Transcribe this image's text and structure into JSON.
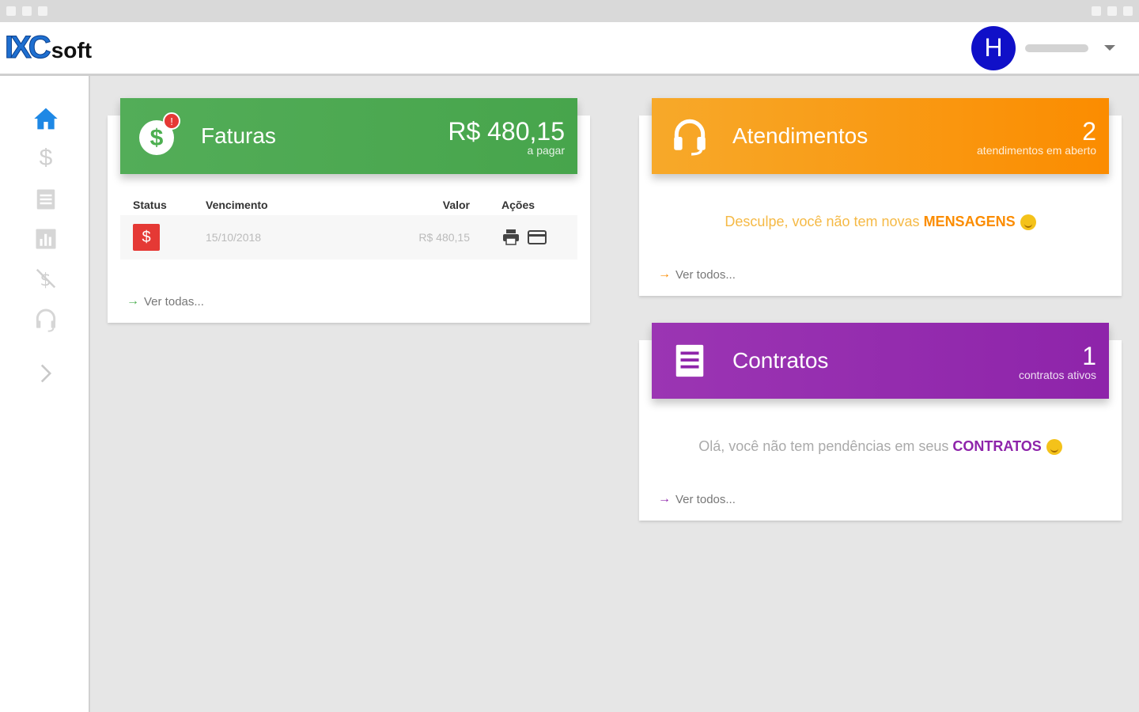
{
  "logo": {
    "brand": "IXC",
    "suffix": "soft"
  },
  "user": {
    "initial": "H"
  },
  "colors": {
    "green": "#4caf50",
    "orange": "#fb8c00",
    "purple": "#8e24aa",
    "blue": "#1e88e5",
    "red": "#e53935",
    "avatar": "#1010c8"
  },
  "sidebar": {
    "items": [
      {
        "icon": "home-icon",
        "active": true
      },
      {
        "icon": "dollar-icon",
        "active": false
      },
      {
        "icon": "list-icon",
        "active": false
      },
      {
        "icon": "bar-chart-icon",
        "active": false
      },
      {
        "icon": "money-off-icon",
        "active": false
      },
      {
        "icon": "headset-icon",
        "active": false
      },
      {
        "icon": "chevron-right-icon",
        "active": false
      }
    ]
  },
  "faturas": {
    "badge": "!",
    "title": "Faturas",
    "amount": "R$ 480,15",
    "amount_sub": "a pagar",
    "columns": [
      "Status",
      "Vencimento",
      "Valor",
      "Ações"
    ],
    "row": {
      "status_symbol": "$",
      "vencimento": "15/10/2018",
      "valor": "R$ 480,15"
    },
    "see_all": "Ver todas..."
  },
  "atendimentos": {
    "title": "Atendimentos",
    "count": "2",
    "count_sub": "atendimentos em aberto",
    "message_prefix": "Desculpe, você não tem novas ",
    "message_bold": "MENSAGENS",
    "see_all": "Ver todos..."
  },
  "contratos": {
    "title": "Contratos",
    "count": "1",
    "count_sub": "contratos ativos",
    "message_prefix": "Olá, você não tem pendências em seus ",
    "message_bold": "CONTRATOS",
    "see_all": "Ver todos..."
  }
}
